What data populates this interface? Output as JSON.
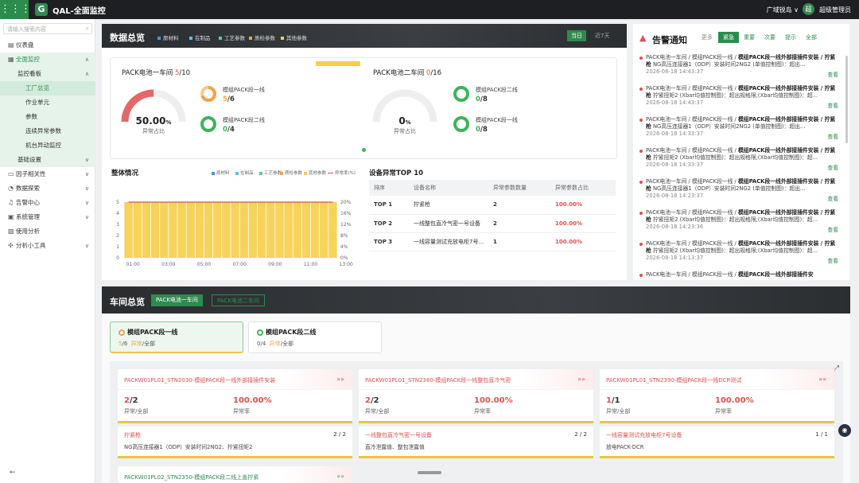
{
  "app": {
    "grid_icon": "grid-icon",
    "logo": "G",
    "title": "QAL-全面监控",
    "region": "广域锐岛 ∨",
    "avatar": "超",
    "user": "超级管理员"
  },
  "sidebar": {
    "search_placeholder": "请输入搜索内容",
    "items": [
      {
        "label": "仪表盘",
        "icon": "dashboard-icon",
        "glyph": "▤"
      },
      {
        "label": "全面监控",
        "icon": "monitor-icon",
        "glyph": "▦",
        "chev": "∧"
      },
      {
        "label": "监控看板",
        "chev": "∧"
      },
      {
        "label": "工厂总览"
      },
      {
        "label": "作业单元"
      },
      {
        "label": "参数"
      },
      {
        "label": "连续异常参数"
      },
      {
        "label": "机台异动监控"
      },
      {
        "label": "基础设置",
        "chev": "∨"
      },
      {
        "label": "因子相关性",
        "icon": "factor-icon",
        "glyph": "▭",
        "chev": "∨"
      },
      {
        "label": "数据探索",
        "icon": "explore-icon",
        "glyph": "◔",
        "chev": "∨"
      },
      {
        "label": "告警中心",
        "icon": "alarm-icon",
        "glyph": "♫",
        "chev": "∨"
      },
      {
        "label": "系统管理",
        "icon": "system-icon",
        "glyph": "▣",
        "chev": "∨"
      },
      {
        "label": "使用分析",
        "icon": "usage-icon",
        "glyph": "▧"
      },
      {
        "label": "分析小工具",
        "icon": "tools-icon",
        "glyph": "✣",
        "chev": "∨"
      }
    ],
    "collapse": "←"
  },
  "overview": {
    "title": "数据总览",
    "legend": [
      {
        "label": "原材料",
        "color": "#4a90e2"
      },
      {
        "label": "在制品",
        "color": "#4fc3f7"
      },
      {
        "label": "工艺参数",
        "color": "#5cc9a7"
      },
      {
        "label": "质检参数",
        "color": "#f0a44a"
      },
      {
        "label": "其他参数",
        "color": "#f5d04a"
      }
    ],
    "btn_today": "当日",
    "btn_7d": "近7天",
    "ws1": {
      "title": "PACK电池一车间 ",
      "abn": "5",
      "total": "/10",
      "pct": "50.00",
      "unit": "%",
      "sub": "异常占比",
      "lines": [
        {
          "name": "模组PACK段一线",
          "abn": "5",
          "total": "/6"
        },
        {
          "name": "模组PACK段二线",
          "abn": "0",
          "total": "/4"
        }
      ]
    },
    "ws2": {
      "title": "PACK电池二车间 ",
      "abn": "0",
      "total": "/16",
      "pct": "0",
      "unit": "%",
      "sub": "异常占比",
      "lines": [
        {
          "name": "模组PACK段二线",
          "abn": "0",
          "total": "/8"
        },
        {
          "name": "模组PACK段一线",
          "abn": "0",
          "total": "/8"
        }
      ]
    }
  },
  "overall": {
    "title": "整体情况",
    "legend": [
      {
        "label": "原材料",
        "color": "#4a90e2"
      },
      {
        "label": "在制品",
        "color": "#4fc3f7"
      },
      {
        "label": "工艺参数",
        "color": "#5cc9a7"
      },
      {
        "label": "质检参数",
        "color": "#f0a44a"
      },
      {
        "label": "其他参数",
        "color": "#f5d04a"
      },
      {
        "label": "异常率(%)",
        "color": "#e05050"
      }
    ]
  },
  "chart_data": {
    "type": "bar",
    "series": [
      {
        "name": "其他参数",
        "values": [
          5,
          5,
          5,
          5,
          5,
          5,
          5,
          5,
          5,
          5,
          5,
          5,
          5,
          5,
          5,
          5,
          5,
          5,
          5,
          5,
          5,
          5,
          5,
          5
        ]
      },
      {
        "name": "异常率(%)",
        "values": [
          20,
          20,
          20,
          20,
          20,
          20,
          20,
          20,
          20,
          20,
          20,
          20,
          20,
          20,
          20,
          20,
          20,
          20,
          20,
          20,
          20,
          20,
          20,
          20
        ]
      }
    ],
    "x_ticks": [
      "01:00",
      "03:00",
      "05:00",
      "07:00",
      "09:00",
      "11:00",
      "13:00"
    ],
    "y_left": [
      "0",
      "1",
      "2",
      "3",
      "4",
      "5"
    ],
    "y_right": [
      "0%",
      "4%",
      "8%",
      "12%",
      "16%",
      "20%"
    ],
    "ylim": [
      0,
      5
    ],
    "y2lim": [
      0,
      20
    ]
  },
  "top10": {
    "title": "设备异常TOP 10",
    "headers": [
      "排序",
      "设备名称",
      "异常参数数量",
      "异常参数占比"
    ],
    "rows": [
      [
        "TOP 1",
        "拧紧枪",
        "2",
        "100.00%"
      ],
      [
        "TOP 2",
        "一线整包直冷气密一号设备",
        "2",
        "100.00%"
      ],
      [
        "TOP 3",
        "一线容量测试充放电柜7号...",
        "1",
        "100.00%"
      ]
    ]
  },
  "alerts": {
    "title": "告警通知",
    "more": "更多",
    "tabs": [
      "紧急",
      "重要",
      "次要",
      "提示",
      "全部"
    ],
    "view": "查看",
    "items": [
      {
        "path": "PACK电池一车间 / 模组PACK段一线 / ",
        "bold": "模组PACK段一线外部接插件安装 / 拧紧枪",
        "desc": " NG高压连接器1（ODP）安装时间2NG2 (单值控制图)：超出...",
        "time": "2026-08-18 14:43:37"
      },
      {
        "path": "PACK电池一车间 / 模组PACK段一线 / ",
        "bold": "模组PACK段一线外部接插件安装 / 拧紧枪",
        "desc": " 拧紧扭矩2 (Xbar均值控制图)：超出规格限;(Xbar均值控制图)：超...",
        "time": "2026-08-18 14:43:37"
      },
      {
        "path": "PACK电池一车间 / 模组PACK段一线 / ",
        "bold": "模组PACK段一线外部接插件安装 / 拧紧枪",
        "desc": " NG高压连接器1（ODP）安装时间2NG2 (单值控制图)：超出...",
        "time": "2026-08-18 14:33:37"
      },
      {
        "path": "PACK电池一车间 / 模组PACK段一线 / ",
        "bold": "模组PACK段一线外部接插件安装 / 拧紧枪",
        "desc": " 拧紧扭矩2 (Xbar均值控制图)：超出规格限;(Xbar均值控制图)：超...",
        "time": "2026-08-18 14:33:37"
      },
      {
        "path": "PACK电池一车间 / 模组PACK段一线 / ",
        "bold": "模组PACK段一线外部接插件安装 / 拧紧枪",
        "desc": " NG高压连接器1（ODP）安装时间2NG2 (单值控制图)：超出...",
        "time": "2026-08-18 14:23:37"
      },
      {
        "path": "PACK电池一车间 / 模组PACK段一线 / ",
        "bold": "模组PACK段一线外部接插件安装 / 拧紧枪",
        "desc": " 拧紧扭矩2 (Xbar均值控制图)：超出规格限;(Xbar均值控制图)：超...",
        "time": "2026-08-18 14:23:36"
      },
      {
        "path": "PACK电池一车间 / 模组PACK段一线 / ",
        "bold": "模组PACK段一线外部接插件安装 / 拧紧枪",
        "desc": " 拧紧扭矩2 (Xbar均值控制图)：超出规格限;(Xbar均值控制图)：超...",
        "time": "2026-08-18 14:13:37"
      },
      {
        "path": "PACK电池一车间 / 模组PACK段一线 / ",
        "bold": "模组PACK段一线外部接插件安",
        "desc": "",
        "time": ""
      }
    ]
  },
  "workshop": {
    "title": "车间总览",
    "tabs": [
      "PACK电池一车间",
      "PACK电池二车间"
    ],
    "lines": [
      {
        "name": "模组PACK段一线",
        "abn": "5",
        "total": "/6",
        "legend_abn": "异常",
        "legend_all": "/全部"
      },
      {
        "name": "模组PACK段二线",
        "abn": "0",
        "total": "/4",
        "legend_abn": "异常",
        "legend_all": "/全部"
      }
    ],
    "stations": [
      {
        "title": "PACKW01PL01_STN2030-模组PACK段一线外部接插件安装",
        "n1a": "2",
        "n1b": "/2",
        "l1": "异常/全部",
        "n2": "100.00%",
        "l2": "异常率"
      },
      {
        "title": "PACKW01PL01_STN2380-模组PACK段一线整包直冷气密",
        "n1a": "2",
        "n1b": "/2",
        "l1": "异常/全部",
        "n2": "100.00%",
        "l2": "异常率"
      },
      {
        "title": "PACKW01PL01_STN2390-模组PACK段一线DCR测试",
        "n1a": "1",
        "n1b": "/1",
        "l1": "异常/全部",
        "n2": "100.00%",
        "l2": "异常率"
      }
    ],
    "details": [
      {
        "t": "拧紧枪",
        "c": "2 / 2",
        "d": "NG高压连接器1（ODP）安装时间2NG2、拧紧扭矩2"
      },
      {
        "t": "一线整包直冷气密一号设备",
        "c": "2 / 2",
        "d": "直冷泄露值、整包泄露值"
      },
      {
        "t": "一线容量测试充放电柜7号设备",
        "c": "1 / 1",
        "d": "放电PACK-DCR"
      }
    ],
    "station4": {
      "title": "PACKW01PL02_STN2350-模组PACK段二线上盖拧紧"
    },
    "expand_icon": "expand-icon",
    "arrow": "»»"
  }
}
